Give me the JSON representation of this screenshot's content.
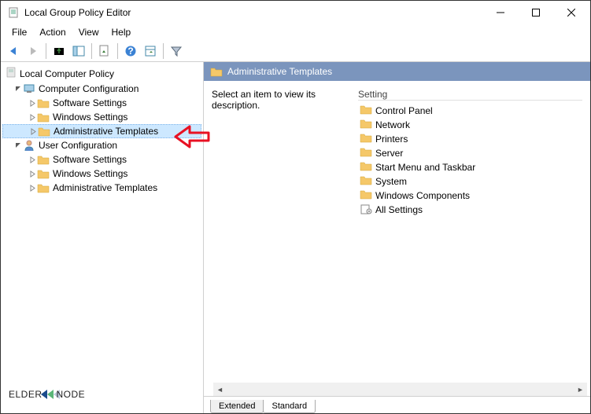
{
  "window": {
    "title": "Local Group Policy Editor"
  },
  "menu": {
    "file": "File",
    "action": "Action",
    "view": "View",
    "help": "Help"
  },
  "tree": {
    "root": "Local Computer Policy",
    "comp_config": "Computer Configuration",
    "comp_software": "Software Settings",
    "comp_windows": "Windows Settings",
    "comp_admin": "Administrative Templates",
    "user_config": "User Configuration",
    "user_software": "Software Settings",
    "user_windows": "Windows Settings",
    "user_admin": "Administrative Templates"
  },
  "detail": {
    "header": "Administrative Templates",
    "description": "Select an item to view its description.",
    "setting_label": "Setting",
    "items": {
      "control_panel": "Control Panel",
      "network": "Network",
      "printers": "Printers",
      "server": "Server",
      "start_menu": "Start Menu and Taskbar",
      "system": "System",
      "windows_comp": "Windows Components",
      "all_settings": "All Settings"
    }
  },
  "tabs": {
    "extended": "Extended",
    "standard": "Standard"
  },
  "watermark": {
    "text_a": "ELDER",
    "text_b": "NODE"
  }
}
